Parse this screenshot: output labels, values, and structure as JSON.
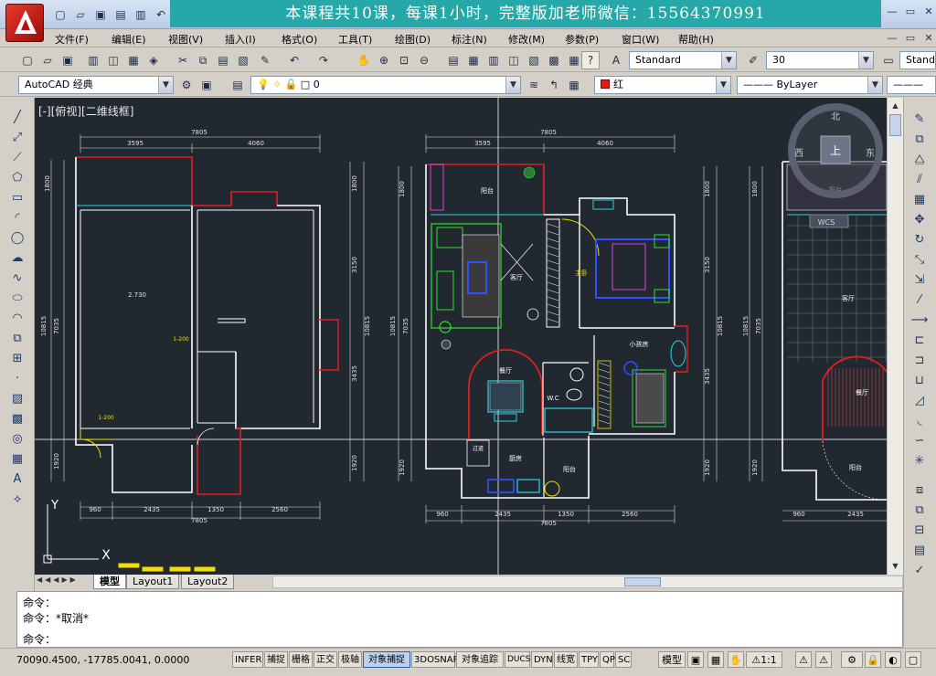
{
  "window": {
    "banner": "本课程共10课，每课1小时，完整版加老师微信：15564370991",
    "controls": [
      "—",
      "▭",
      "✕"
    ],
    "doc_controls": [
      "—",
      "▭",
      "✕"
    ]
  },
  "menu": [
    "文件(F)",
    "编辑(E)",
    "视图(V)",
    "插入(I)",
    "格式(O)",
    "工具(T)",
    "绘图(D)",
    "标注(N)",
    "修改(M)",
    "参数(P)",
    "窗口(W)",
    "帮助(H)"
  ],
  "toolbar": {
    "text_style": "Standard",
    "text_height": "30",
    "dim_style": "Stand",
    "workspace": "AutoCAD 经典",
    "layer": "0",
    "color": "红",
    "linetype": "ByLayer"
  },
  "viewport": {
    "label": "[-][俯视][二维线框]",
    "compass": {
      "north": "北",
      "south": "南",
      "east": "东",
      "west": "西",
      "top": "上",
      "wcs": "WCS"
    },
    "ucs": {
      "x": "X",
      "y": "Y"
    }
  },
  "drawing": {
    "plan_left": {
      "top_dims": [
        "7805",
        "3595",
        "4060"
      ],
      "bottom_dims": [
        "960",
        "2435",
        "1350",
        "2560"
      ],
      "bottom_total": "7805",
      "left_dims": [
        "1800",
        "10815",
        "7035",
        "1920"
      ],
      "right_dims": [
        "1800",
        "3150",
        "10815",
        "3435",
        "1920"
      ],
      "room_labels": [
        "2.730",
        "1-200",
        "1-200"
      ]
    },
    "plan_mid": {
      "top_dims": [
        "7805",
        "3595",
        "4060"
      ],
      "bottom_dims": [
        "960",
        "2435",
        "1350",
        "2560"
      ],
      "bottom_total": "7805",
      "left_dims": [
        "1800",
        "10815",
        "7035",
        "1920"
      ],
      "right_dims": [
        "1800",
        "3150",
        "10815",
        "3435",
        "1920"
      ],
      "rooms": [
        "阳台",
        "客厅",
        "主卧",
        "小孩房",
        "餐厅",
        "W.C",
        "厨房",
        "阳台",
        "过道"
      ]
    },
    "plan_right": {
      "left_dims": [
        "1800",
        "10815",
        "7035",
        "1920"
      ],
      "bottom_dims": [
        "960",
        "2435"
      ],
      "rooms": [
        "阳台",
        "客厅",
        "餐厅",
        "阳台"
      ]
    }
  },
  "tabs": [
    "模型",
    "Layout1",
    "Layout2"
  ],
  "command": {
    "lines": [
      "命令：",
      "命令：*取消*"
    ],
    "prompt": "命令："
  },
  "status": {
    "coords": "70090.4500, -17785.0041, 0.0000",
    "buttons": [
      {
        "label": "INFER",
        "on": false
      },
      {
        "label": "捕捉",
        "on": false
      },
      {
        "label": "栅格",
        "on": false
      },
      {
        "label": "正交",
        "on": false
      },
      {
        "label": "极轴",
        "on": false
      },
      {
        "label": "对象捕捉",
        "on": true
      },
      {
        "label": "3DOSNAP",
        "on": false
      },
      {
        "label": "对象追踪",
        "on": false
      },
      {
        "label": "DUCS",
        "on": false
      },
      {
        "label": "DYN",
        "on": false
      },
      {
        "label": "线宽",
        "on": false
      },
      {
        "label": "TPY",
        "on": false
      },
      {
        "label": "QP",
        "on": false
      },
      {
        "label": "SC",
        "on": false
      }
    ],
    "space": "模型",
    "scale": "1:1"
  },
  "colors": {
    "canvas": "#212830",
    "wall": "#ffffff",
    "dim": "#e0e0e0",
    "red": "#e02020",
    "cyan": "#30d0e0",
    "green": "#30e030",
    "yellow": "#f0e000",
    "blue": "#3050ff",
    "magenta": "#e040e0",
    "banner": "#26a8a8"
  }
}
